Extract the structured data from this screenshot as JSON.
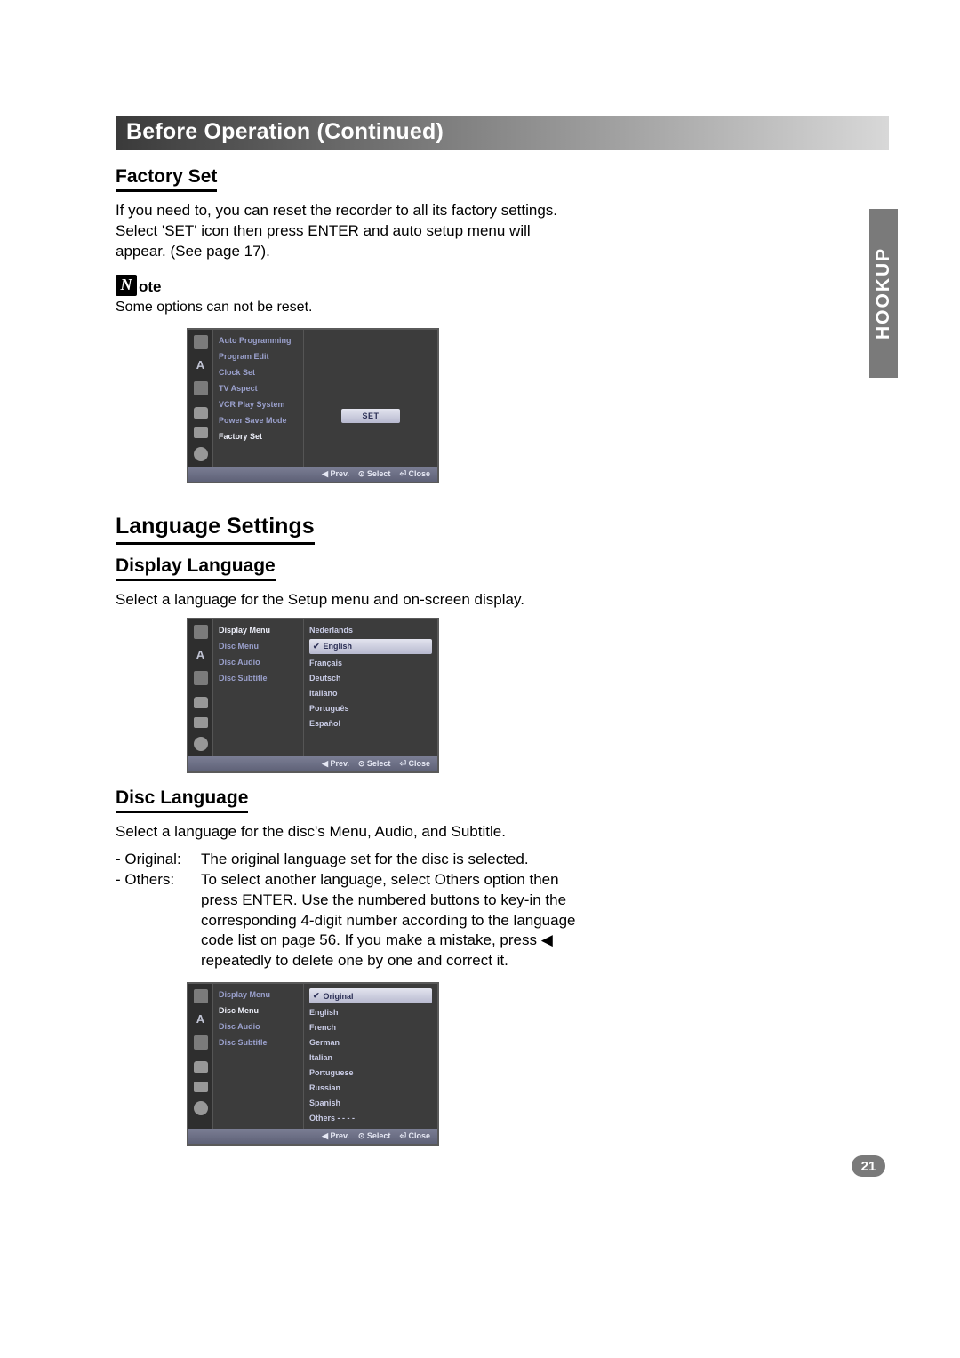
{
  "section_header": "Before Operation (Continued)",
  "side_tab": "HOOKUP",
  "page_number": "21",
  "factory_set": {
    "heading": "Factory Set",
    "body": "If you need to, you can reset the recorder to all its factory settings. Select 'SET' icon then press ENTER and auto setup menu will appear. (See page 17).",
    "note_icon_letter": "N",
    "note_label": "ote",
    "note_text": "Some options can not be reset."
  },
  "osd_footer": {
    "prev": "◀ Prev.",
    "select": "⊙ Select",
    "close": "⏎ Close"
  },
  "osd1": {
    "sidebar_letter": "A",
    "mid_items": [
      "Auto Programming",
      "Program Edit",
      "Clock Set",
      "TV Aspect",
      "VCR Play System",
      "Power Save Mode",
      "Factory Set"
    ],
    "mid_selected_index": 6,
    "right_button": "SET"
  },
  "language_settings": {
    "title": "Language Settings",
    "display_language": {
      "heading": "Display Language",
      "body": "Select a language for the Setup menu and on-screen display."
    },
    "disc_language": {
      "heading": "Disc Language",
      "body": "Select a language for the disc's Menu, Audio, and Subtitle.",
      "original_label": "- Original:",
      "original_text": "The original language set for the disc is selected.",
      "others_label": "- Others:",
      "others_text": "To select another language, select Others option then press ENTER. Use the numbered buttons to key-in the corresponding 4-digit number according to the language code list on page 56. If you make a mistake, press ◀ repeatedly to delete one by one and correct it."
    }
  },
  "osd2": {
    "sidebar_letter": "A",
    "mid_items": [
      "Display Menu",
      "Disc Menu",
      "Disc Audio",
      "Disc Subtitle"
    ],
    "mid_selected_index": 0,
    "right_items": [
      "Nederlands",
      "English",
      "Français",
      "Deutsch",
      "Italiano",
      "Português",
      "Español"
    ],
    "right_selected_index": 1
  },
  "osd3": {
    "sidebar_letter": "A",
    "mid_items": [
      "Display Menu",
      "Disc Menu",
      "Disc Audio",
      "Disc Subtitle"
    ],
    "mid_selected_index": 1,
    "right_items": [
      "Original",
      "English",
      "French",
      "German",
      "Italian",
      "Portuguese",
      "Russian",
      "Spanish",
      "Others   - - - -"
    ],
    "right_selected_index": 0
  }
}
